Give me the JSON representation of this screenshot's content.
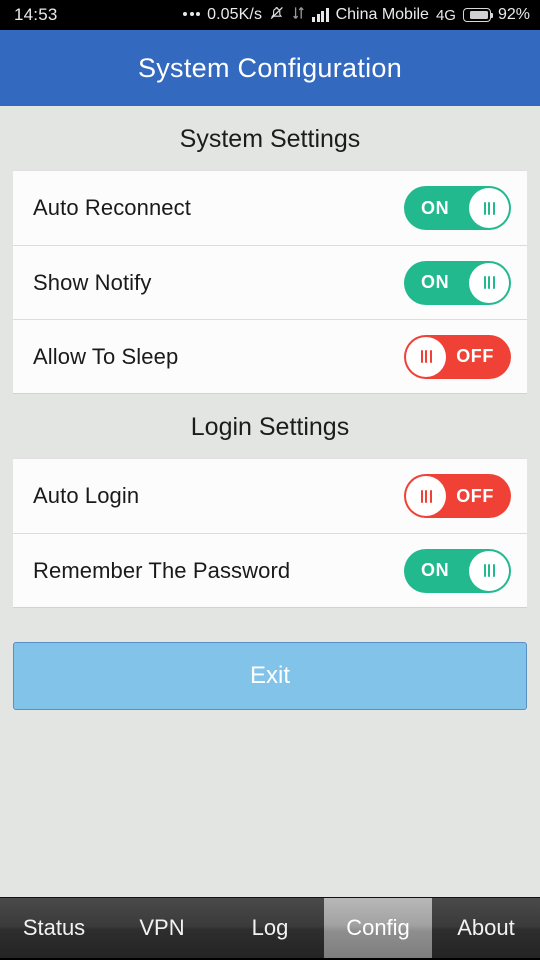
{
  "status_bar": {
    "time": "14:53",
    "dots_icon": "more-dots-icon",
    "net_speed": "0.05K/s",
    "mute_icon": "bell-muted-icon",
    "data_arrows_icon": "data-transfer-arrows-icon",
    "signal_icon": "cellular-signal-icon",
    "carrier": "China Mobile",
    "network_type": "4G",
    "battery_icon": "battery-icon",
    "battery_percent": "92%"
  },
  "header": {
    "title": "System Configuration",
    "background_color": "#3369bf"
  },
  "sections": [
    {
      "title": "System Settings",
      "rows": [
        {
          "label": "Auto Reconnect",
          "toggle_state": "ON"
        },
        {
          "label": "Show Notify",
          "toggle_state": "ON"
        },
        {
          "label": "Allow To Sleep",
          "toggle_state": "OFF"
        }
      ]
    },
    {
      "title": "Login Settings",
      "rows": [
        {
          "label": "Auto Login",
          "toggle_state": "OFF"
        },
        {
          "label": "Remember The Password",
          "toggle_state": "ON"
        }
      ]
    }
  ],
  "exit_button": {
    "label": "Exit",
    "background_color": "#82c3ea"
  },
  "tab_bar": {
    "active_index": 3,
    "items": [
      {
        "label": "Status"
      },
      {
        "label": "VPN"
      },
      {
        "label": "Log"
      },
      {
        "label": "Config"
      },
      {
        "label": "About"
      }
    ]
  },
  "colors": {
    "toggle_on": "#22b98e",
    "toggle_off": "#ef4136",
    "page_background": "#e3e5e2",
    "card_background": "#fcfcfc"
  }
}
